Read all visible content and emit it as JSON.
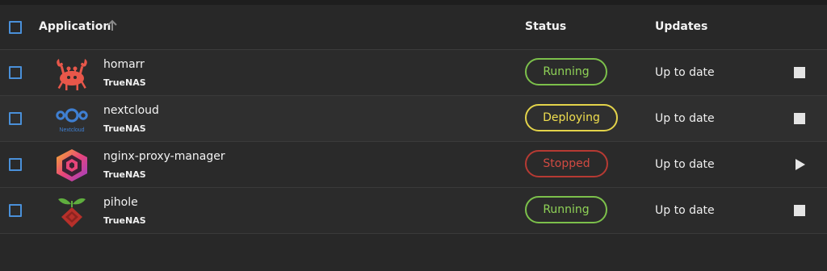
{
  "table": {
    "headers": {
      "application": "Application",
      "status": "Status",
      "updates": "Updates"
    },
    "rows": [
      {
        "name": "homarr",
        "train": "TrueNAS",
        "status": "Running",
        "status_type": "running",
        "updates": "Up to date",
        "action": "stop",
        "icon": "homarr-crab-icon"
      },
      {
        "name": "nextcloud",
        "train": "TrueNAS",
        "status": "Deploying",
        "status_type": "deploying",
        "updates": "Up to date",
        "action": "stop",
        "icon": "nextcloud-icon"
      },
      {
        "name": "nginx-proxy-manager",
        "train": "TrueNAS",
        "status": "Stopped",
        "status_type": "stopped",
        "updates": "Up to date",
        "action": "start",
        "icon": "nginx-proxy-manager-icon"
      },
      {
        "name": "pihole",
        "train": "TrueNAS",
        "status": "Running",
        "status_type": "running",
        "updates": "Up to date",
        "action": "stop",
        "icon": "pihole-icon"
      }
    ],
    "icon_logo_text": {
      "nextcloud": "Nextcloud"
    }
  },
  "colors": {
    "accent": "#4a90d9",
    "running": "#7cc04b",
    "deploying": "#e3d34a",
    "stopped": "#b63a33"
  }
}
